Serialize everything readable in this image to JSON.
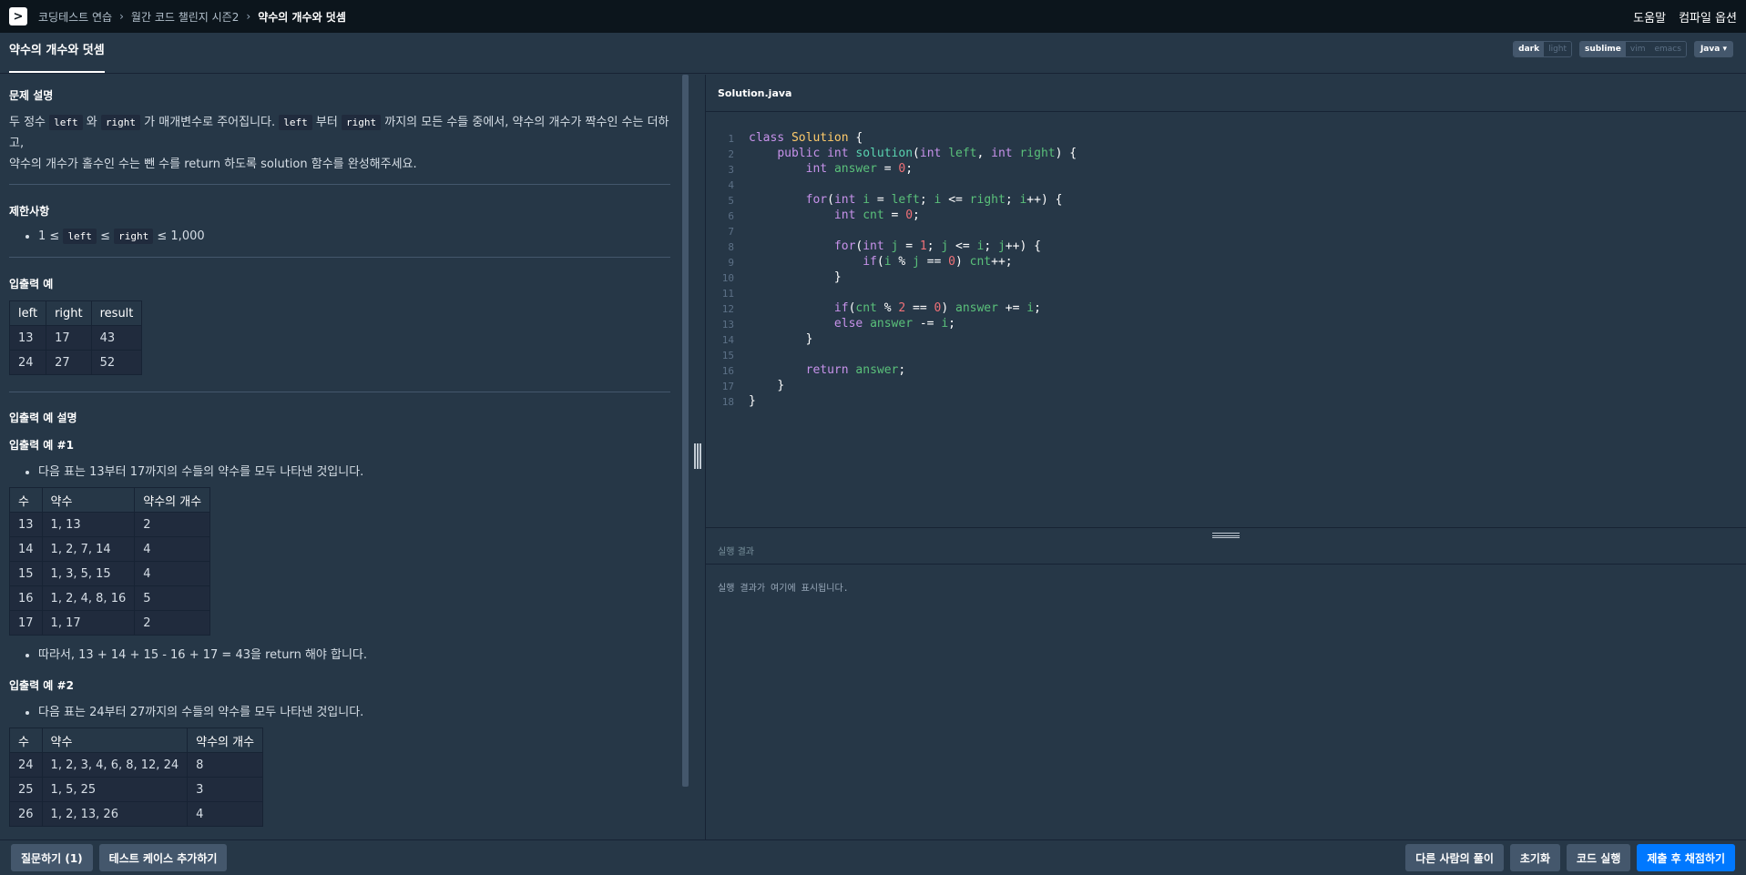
{
  "breadcrumb": [
    "코딩테스트 연습",
    "월간 코드 챌린지 시즌2",
    "약수의 개수와 덧셈"
  ],
  "top_links": [
    "도움말",
    "컴파일 옵션"
  ],
  "problem_tab": "약수의 개수와 덧셈",
  "editor_options": {
    "themes": [
      "dark",
      "light"
    ],
    "active_theme": "dark",
    "keymaps": [
      "sublime",
      "vim",
      "emacs"
    ],
    "active_keymap": "sublime",
    "language": "Java"
  },
  "problem": {
    "desc_title": "문제 설명",
    "desc_line1": {
      "t1": "두 정수",
      "c1": "left",
      "t2": "와",
      "c2": "right",
      "t3": "가 매개변수로 주어집니다.",
      "c3": "left",
      "t4": "부터",
      "c4": "right",
      "t5": "까지의 모든 수들 중에서, 약수의 개수가 짝수인 수는 더하고,"
    },
    "desc_line2": "약수의 개수가 홀수인 수는 뺀 수를 return 하도록 solution 함수를 완성해주세요.",
    "limits_title": "제한사항",
    "limit": {
      "t1": "1 ≤",
      "c1": "left",
      "t2": "≤",
      "c2": "right",
      "t3": "≤ 1,000"
    },
    "io_title": "입출력 예",
    "io_table": {
      "headers": [
        "left",
        "right",
        "result"
      ],
      "rows": [
        [
          "13",
          "17",
          "43"
        ],
        [
          "24",
          "27",
          "52"
        ]
      ]
    },
    "io_desc_title": "입출력 예 설명",
    "ex1_title": "입출력 예 #1",
    "ex1_bullet": "다음 표는 13부터 17까지의 수들의 약수를 모두 나타낸 것입니다.",
    "ex1_table": {
      "headers": [
        "수",
        "약수",
        "약수의 개수"
      ],
      "rows": [
        [
          "13",
          "1, 13",
          "2"
        ],
        [
          "14",
          "1, 2, 7, 14",
          "4"
        ],
        [
          "15",
          "1, 3, 5, 15",
          "4"
        ],
        [
          "16",
          "1, 2, 4, 8, 16",
          "5"
        ],
        [
          "17",
          "1, 17",
          "2"
        ]
      ]
    },
    "ex1_result": "따라서, 13 + 14 + 15 - 16 + 17 = 43을 return 해야 합니다.",
    "ex2_title": "입출력 예 #2",
    "ex2_bullet": "다음 표는 24부터 27까지의 수들의 약수를 모두 나타낸 것입니다.",
    "ex2_table": {
      "headers": [
        "수",
        "약수",
        "약수의 개수"
      ],
      "rows": [
        [
          "24",
          "1, 2, 3, 4, 6, 8, 12, 24",
          "8"
        ],
        [
          "25",
          "1, 5, 25",
          "3"
        ],
        [
          "26",
          "1, 2, 13, 26",
          "4"
        ]
      ]
    }
  },
  "file_name": "Solution.java",
  "code_lines": [
    "class Solution {",
    "    public int solution(int left, int right) {",
    "        int answer = 0;",
    "",
    "        for(int i = left; i <= right; i++) {",
    "            int cnt = 0;",
    "",
    "            for(int j = 1; j <= i; j++) {",
    "                if(i % j == 0) cnt++;",
    "            }",
    "",
    "            if(cnt % 2 == 0) answer += i;",
    "            else answer -= i;",
    "        }",
    "",
    "        return answer;",
    "    }",
    "}"
  ],
  "result_label": "실행 결과",
  "result_placeholder": "실행 결과가 여기에 표시됩니다.",
  "footer_left": [
    "질문하기 (1)",
    "테스트 케이스 추가하기"
  ],
  "footer_right": [
    "다른 사람의 풀이",
    "초기화",
    "코드 실행",
    "제출 후 채점하기"
  ],
  "colors": {
    "accent": "#0078ff",
    "background": "#263747",
    "topbar": "#0c151c"
  }
}
